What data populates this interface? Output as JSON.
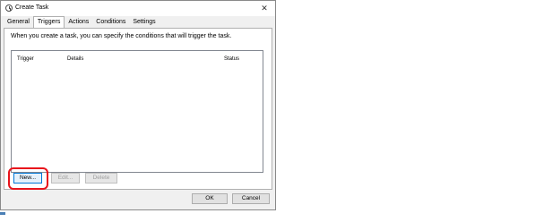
{
  "window": {
    "title": "Create Task",
    "close_glyph": "✕"
  },
  "tabs": [
    {
      "label": "General",
      "active": false
    },
    {
      "label": "Triggers",
      "active": true
    },
    {
      "label": "Actions",
      "active": false
    },
    {
      "label": "Conditions",
      "active": false
    },
    {
      "label": "Settings",
      "active": false
    }
  ],
  "triggers_tab": {
    "description": "When you create a task, you can specify the conditions that will trigger the task.",
    "columns": [
      "Trigger",
      "Details",
      "Status"
    ],
    "rows": [],
    "buttons": {
      "new": "New...",
      "edit": "Edit...",
      "delete": "Delete"
    }
  },
  "footer": {
    "ok": "OK",
    "cancel": "Cancel"
  },
  "colors": {
    "highlight": "#e8131b",
    "focus": "#0078d7"
  },
  "icons": [
    "clock-icon",
    "close-icon"
  ]
}
